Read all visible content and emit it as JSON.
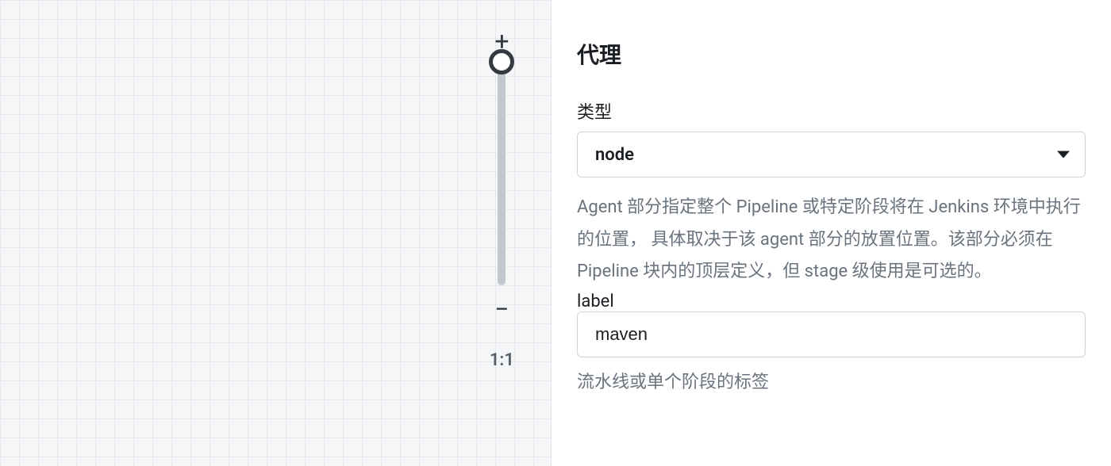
{
  "canvas": {
    "zoom_plus": "+",
    "zoom_minus": "−",
    "zoom_ratio": "1:1"
  },
  "form": {
    "section_title": "代理",
    "type_label": "类型",
    "type_value": "node",
    "type_help": "Agent 部分指定整个 Pipeline 或特定阶段将在 Jenkins 环境中执行的位置， 具体取决于该 agent 部分的放置位置。该部分必须在 Pipeline 块内的顶层定义，但 stage 级使用是可选的。",
    "label_label": "label",
    "label_value": "maven",
    "label_help": "流水线或单个阶段的标签"
  }
}
